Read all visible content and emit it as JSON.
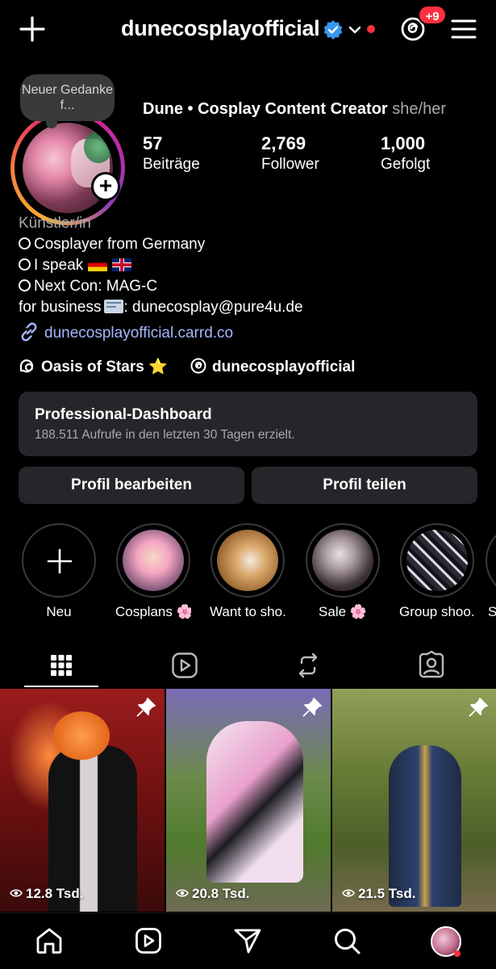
{
  "header": {
    "username": "dunecosplayofficial",
    "notification_count": "+9",
    "accent_color": "#ff3040",
    "verified_color": "#3897f0"
  },
  "profile": {
    "note": "Neuer Gedanke f...",
    "full_name": "Dune • Cosplay Content Creator",
    "pronouns": "she/her",
    "stats": [
      {
        "value": "57",
        "label": "Beiträge"
      },
      {
        "value": "2,769",
        "label": "Follower"
      },
      {
        "value": "1,000",
        "label": "Gefolgt"
      }
    ],
    "category": "Künstler/in",
    "bio": {
      "line1": "Cosplayer from Germany",
      "line2": "I speak",
      "line3": "Next Con: MAG-C",
      "line4_prefix": "for business",
      "line4_suffix": ": dunecosplay@pure4u.de"
    },
    "link": "dunecosplayofficial.carrd.co",
    "link_color": "#a4b6ff",
    "channel_name": "Oasis of Stars",
    "channel_star": "⭐",
    "threads_handle": "dunecosplayofficial"
  },
  "dashboard": {
    "title": "Professional-Dashboard",
    "subtitle": "188.511 Aufrufe in den letzten 30 Tagen erzielt."
  },
  "buttons": {
    "edit": "Profil bearbeiten",
    "share": "Profil teilen"
  },
  "highlights": [
    {
      "label": "Neu"
    },
    {
      "label": "Cosplans 🌸"
    },
    {
      "label": "Want to sho..."
    },
    {
      "label": "Sale 🌸"
    },
    {
      "label": "Group shoo..."
    },
    {
      "label": "S"
    }
  ],
  "tabs": [
    {
      "icon": "grid-icon"
    },
    {
      "icon": "reels-icon"
    },
    {
      "icon": "reposts-icon"
    },
    {
      "icon": "tagged-icon"
    }
  ],
  "posts": [
    {
      "views": "12.8 Tsd.",
      "pinned": true
    },
    {
      "views": "20.8 Tsd.",
      "pinned": true
    },
    {
      "views": "21.5 Tsd.",
      "pinned": true
    }
  ],
  "bottom_nav": [
    {
      "icon": "home-icon"
    },
    {
      "icon": "reels-icon"
    },
    {
      "icon": "send-icon"
    },
    {
      "icon": "search-icon"
    },
    {
      "icon": "profile-avatar"
    }
  ]
}
